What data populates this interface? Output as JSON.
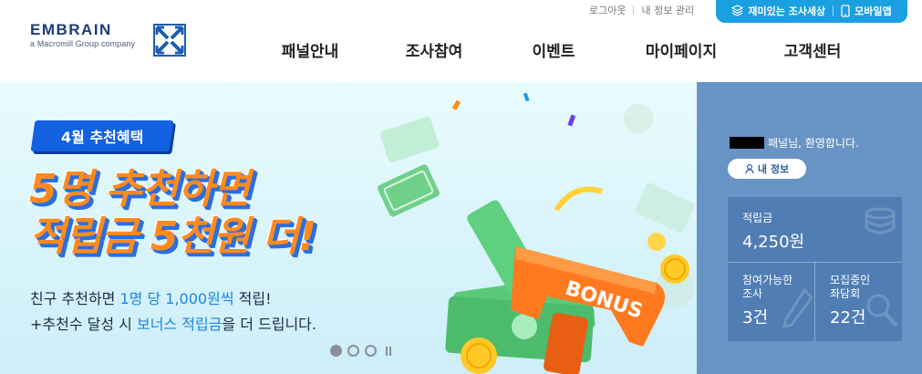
{
  "brand": {
    "name": "EMBRAIN",
    "tagline": "a Macromill Group company"
  },
  "util_links": [
    {
      "label": "로그아웃"
    },
    {
      "label": "내 정보 관리"
    }
  ],
  "pill": {
    "fun_survey": "재미있는 조사세상",
    "mobile_app": "모바일앱"
  },
  "nav": [
    {
      "label": "패널안내"
    },
    {
      "label": "조사참여"
    },
    {
      "label": "이벤트"
    },
    {
      "label": "마이페이지"
    },
    {
      "label": "고객센터"
    }
  ],
  "hero": {
    "badge": "4월 추천혜택",
    "headline_1": "5명 추천하면",
    "headline_2": "적립금 5천원 더!",
    "desc1_a": "친구 추천하면 ",
    "desc1_hl": "1명 당 1,000원씩",
    "desc1_b": " 적립!",
    "desc2_a": "+추천수 달성 시 ",
    "desc2_hl": "보너스 적립금",
    "desc2_b": "을 더 드립니다.",
    "gun_text": "BONUS",
    "slides_total": 3,
    "slide_active": 1
  },
  "side": {
    "welcome": "패널님, 환영합니다.",
    "myinfo_button": "내 정보",
    "points_label": "적립금",
    "points_value": "4,250원",
    "available_label_1": "참여가능한",
    "available_label_2": "조사",
    "available_value": "3건",
    "recruit_label_1": "모집중인",
    "recruit_label_2": "좌담회",
    "recruit_value": "22건"
  },
  "colors": {
    "brand_navy": "#1c3d78",
    "pill_blue": "#1a9fe0",
    "side_panel": "#6794c4",
    "stats_box": "#4f7db4",
    "headline_orange": "#ff8a1e",
    "badge_blue": "#1261e0",
    "highlight_blue": "#1b86e6"
  }
}
